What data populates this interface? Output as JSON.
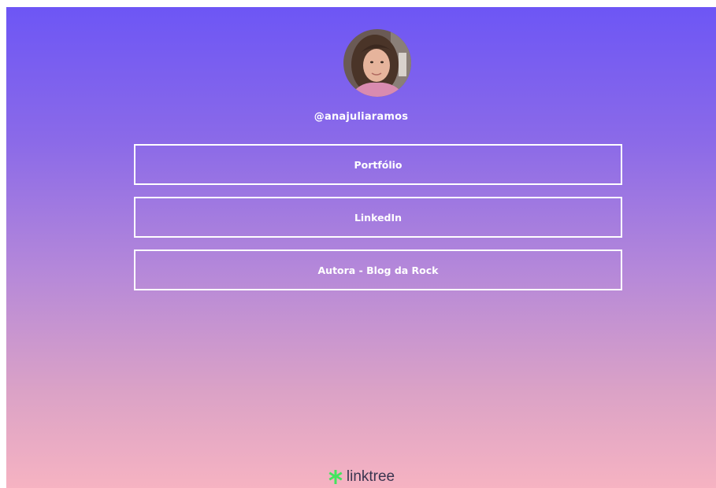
{
  "profile": {
    "username": "@anajuliaramos"
  },
  "links": [
    {
      "label": "Portfólio"
    },
    {
      "label": "LinkedIn"
    },
    {
      "label": "Autora - Blog da Rock"
    }
  ],
  "footer": {
    "brand": "linktree",
    "logo_icon": "linktree-logo-icon",
    "logo_color": "#43e55e"
  },
  "colors": {
    "gradient_top": "#6d56f5",
    "gradient_bottom": "#f6b3c2",
    "text": "#ffffff"
  }
}
